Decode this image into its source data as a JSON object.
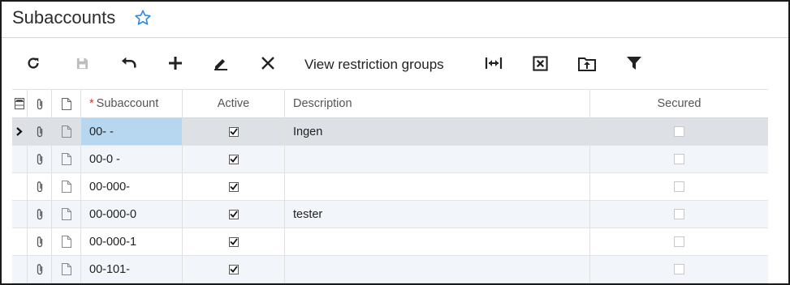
{
  "page": {
    "title": "Subaccounts"
  },
  "toolbar": {
    "view_restriction_groups": "View restriction groups"
  },
  "columns": {
    "subaccount": "Subaccount",
    "required_marker": "*",
    "active": "Active",
    "description": "Description",
    "secured": "Secured"
  },
  "rows": [
    {
      "subaccount": "00- -",
      "active": true,
      "description": "Ingen",
      "secured": false,
      "selected": true
    },
    {
      "subaccount": "00-0 -",
      "active": true,
      "description": "",
      "secured": false
    },
    {
      "subaccount": "00-000-",
      "active": true,
      "description": "",
      "secured": false
    },
    {
      "subaccount": "00-000-0",
      "active": true,
      "description": "tester",
      "secured": false
    },
    {
      "subaccount": "00-000-1",
      "active": true,
      "description": "",
      "secured": false
    },
    {
      "subaccount": "00-101-",
      "active": true,
      "description": "",
      "secured": false
    }
  ],
  "colors": {
    "star": "#2f8be0",
    "selected_row": "#dde1e5",
    "active_cell": "#b7d7f0",
    "alt_row": "#f2f5f9"
  },
  "icons": [
    "star-icon",
    "refresh-icon",
    "save-icon",
    "undo-icon",
    "add-icon",
    "edit-icon",
    "delete-icon",
    "fit-columns-icon",
    "export-excel-icon",
    "upload-icon",
    "filter-icon",
    "row-selector-icon",
    "attachment-icon",
    "note-icon",
    "row-pointer-icon"
  ]
}
